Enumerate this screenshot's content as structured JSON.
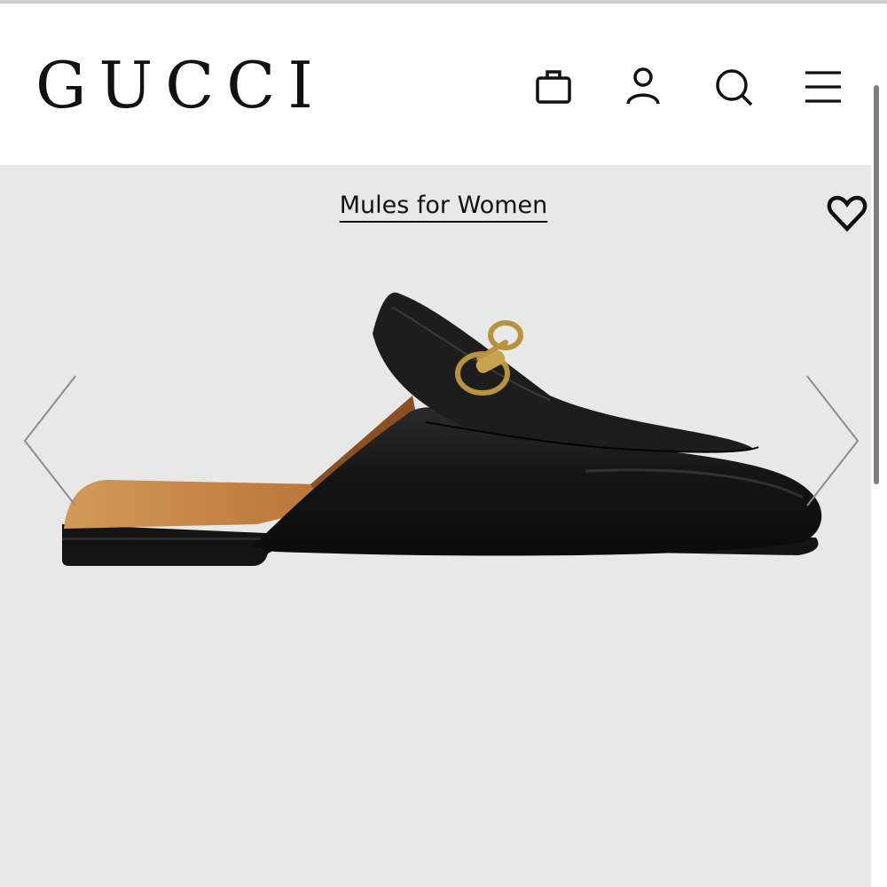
{
  "header": {
    "logo": "GUCCI",
    "icons": [
      "shopping-bag-icon",
      "account-icon",
      "search-icon",
      "menu-icon"
    ]
  },
  "product": {
    "category_link": "Mules for Women",
    "wishlist_icon": "heart-icon",
    "nav": [
      "chevron-left-icon",
      "chevron-right-icon"
    ]
  },
  "colors": {
    "text": "#111111",
    "gallery_bg": "#e8e8e8",
    "header_bg": "#ffffff"
  }
}
